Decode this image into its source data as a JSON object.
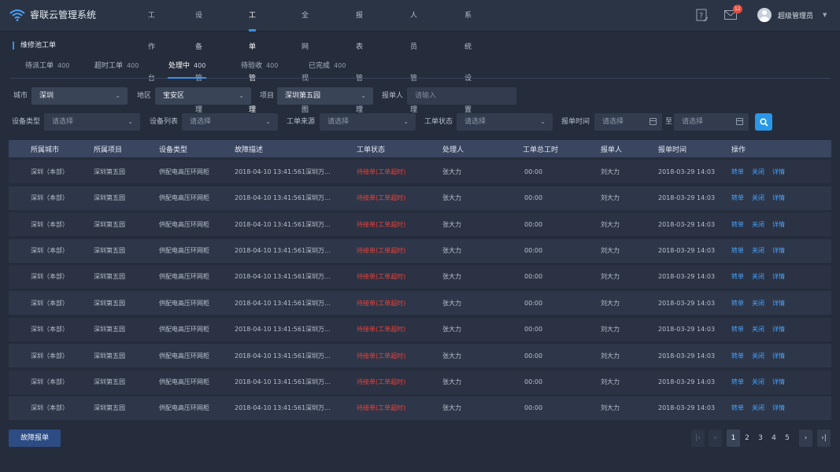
{
  "app": {
    "title": "睿联云管理系统"
  },
  "nav": {
    "items": [
      "工作台",
      "设备管理",
      "工单管理",
      "全网视图",
      "报表管理",
      "人员管理",
      "系统设置"
    ],
    "active": "工单管理"
  },
  "header": {
    "notification_count": "12",
    "user_name": "超级管理员"
  },
  "section": {
    "title": "维修池工单"
  },
  "tabs": [
    {
      "label": "待派工单",
      "count": "400"
    },
    {
      "label": "超时工单",
      "count": "400"
    },
    {
      "label": "处理中",
      "count": "400"
    },
    {
      "label": "待验收",
      "count": "400"
    },
    {
      "label": "已完成",
      "count": "400"
    }
  ],
  "filters": {
    "city_label": "城市",
    "city_value": "深圳",
    "area_label": "地区",
    "area_value": "宝安区",
    "project_label": "项目",
    "project_value": "深圳第五园",
    "reporter_label": "报单人",
    "reporter_placeholder": "请输入",
    "device_type_label": "设备类型",
    "device_type_placeholder": "请选择",
    "device_list_label": "设备列表",
    "device_list_placeholder": "请选择",
    "source_label": "工单来源",
    "source_placeholder": "请选择",
    "status_label": "工单状态",
    "status_placeholder": "请选择",
    "time_label": "报单时间",
    "time_start_placeholder": "请选择",
    "time_sep": "至",
    "time_end_placeholder": "请选择"
  },
  "table": {
    "headers": [
      "所属城市",
      "所属项目",
      "设备类型",
      "故障描述",
      "工单状态",
      "处理人",
      "工单总工时",
      "报单人",
      "报单时间",
      "操作"
    ],
    "rows": [
      [
        "深圳（本部）",
        "深圳第五园",
        "供配电高压环网柜",
        "2018-04-10 13:41:561深圳万...",
        "待接单(工单超时)",
        "张大力",
        "00:00",
        "刘大力",
        "2018-03-29 14:03"
      ],
      [
        "深圳（本部）",
        "深圳第五园",
        "供配电高压环网柜",
        "2018-04-10 13:41:561深圳万...",
        "待接单(工单超时)",
        "张大力",
        "00:00",
        "刘大力",
        "2018-03-29 14:03"
      ],
      [
        "深圳（本部）",
        "深圳第五园",
        "供配电高压环网柜",
        "2018-04-10 13:41:561深圳万...",
        "待接单(工单超时)",
        "张大力",
        "00:00",
        "刘大力",
        "2018-03-29 14:03"
      ],
      [
        "深圳（本部）",
        "深圳第五园",
        "供配电高压环网柜",
        "2018-04-10 13:41:561深圳万...",
        "待接单(工单超时)",
        "张大力",
        "00:00",
        "刘大力",
        "2018-03-29 14:03"
      ],
      [
        "深圳（本部）",
        "深圳第五园",
        "供配电高压环网柜",
        "2018-04-10 13:41:561深圳万...",
        "待接单(工单超时)",
        "张大力",
        "00:00",
        "刘大力",
        "2018-03-29 14:03"
      ],
      [
        "深圳（本部）",
        "深圳第五园",
        "供配电高压环网柜",
        "2018-04-10 13:41:561深圳万...",
        "待接单(工单超时)",
        "张大力",
        "00:00",
        "刘大力",
        "2018-03-29 14:03"
      ],
      [
        "深圳（本部）",
        "深圳第五园",
        "供配电高压环网柜",
        "2018-04-10 13:41:561深圳万...",
        "待接单(工单超时)",
        "张大力",
        "00:00",
        "刘大力",
        "2018-03-29 14:03"
      ],
      [
        "深圳（本部）",
        "深圳第五园",
        "供配电高压环网柜",
        "2018-04-10 13:41:561深圳万...",
        "待接单(工单超时)",
        "张大力",
        "00:00",
        "刘大力",
        "2018-03-29 14:03"
      ],
      [
        "深圳（本部）",
        "深圳第五园",
        "供配电高压环网柜",
        "2018-04-10 13:41:561深圳万...",
        "待接单(工单超时)",
        "张大力",
        "00:00",
        "刘大力",
        "2018-03-29 14:03"
      ],
      [
        "深圳（本部）",
        "深圳第五园",
        "供配电高压环网柜",
        "2018-04-10 13:41:561深圳万...",
        "待接单(工单超时)",
        "张大力",
        "00:00",
        "刘大力",
        "2018-03-29 14:03"
      ]
    ],
    "actions": [
      "转单",
      "关闭",
      "详情"
    ]
  },
  "footer": {
    "fault_button": "故障报单",
    "pages": [
      "1",
      "2",
      "3",
      "4",
      "5"
    ],
    "current_page": "1"
  },
  "colors": {
    "accent": "#3a8ee6",
    "status_alert": "#e8413c",
    "link": "#4aa3ff"
  }
}
